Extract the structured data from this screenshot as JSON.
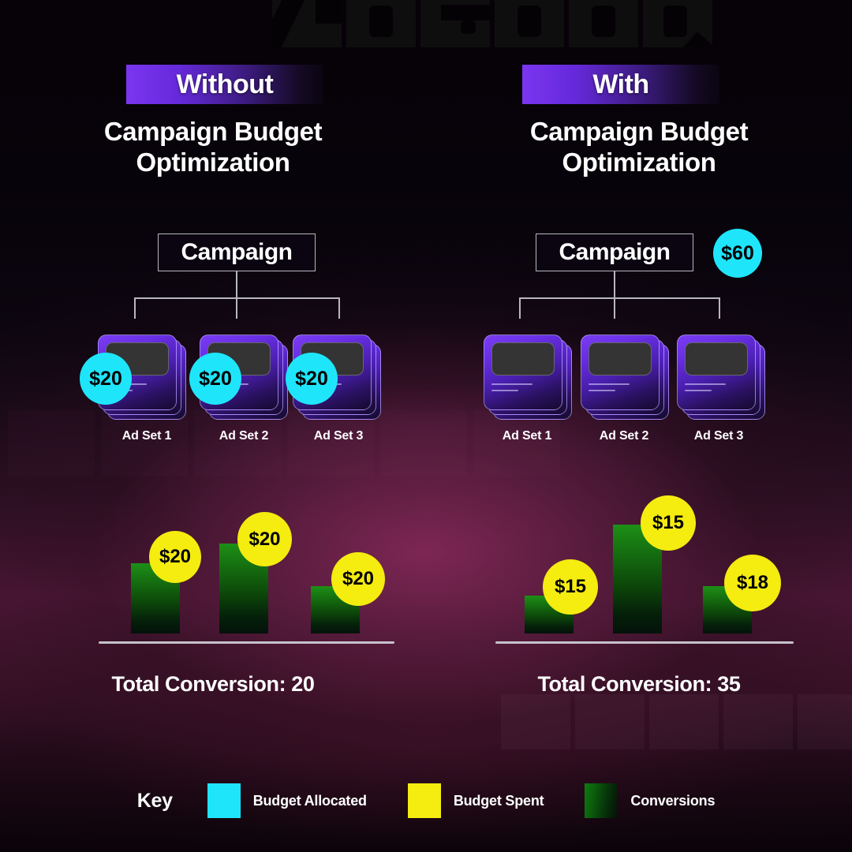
{
  "watermark": {
    "text": "NOGOOD"
  },
  "panels": [
    {
      "id": "without",
      "badge": "Without",
      "title_line1": "Campaign Budget",
      "title_line2": "Optimization",
      "campaign_label": "Campaign",
      "campaign_budget_bubble": "",
      "ad_sets": [
        {
          "label": "Ad Set 1",
          "allocated": "$20"
        },
        {
          "label": "Ad Set 2",
          "allocated": "$20"
        },
        {
          "label": "Ad Set 3",
          "allocated": "$20"
        }
      ],
      "spend_bubbles": [
        "$20",
        "$20",
        "$20"
      ],
      "total_conversion": "Total Conversion: 20"
    },
    {
      "id": "with",
      "badge": "With",
      "title_line1": "Campaign Budget",
      "title_line2": "Optimization",
      "campaign_label": "Campaign",
      "campaign_budget_bubble": "$60",
      "ad_sets": [
        {
          "label": "Ad Set 1",
          "allocated": ""
        },
        {
          "label": "Ad Set 2",
          "allocated": ""
        },
        {
          "label": "Ad Set 3",
          "allocated": ""
        }
      ],
      "spend_bubbles": [
        "$15",
        "$15",
        "$18"
      ],
      "total_conversion": "Total Conversion: 35"
    }
  ],
  "legend": {
    "key_label": "Key",
    "items": [
      {
        "swatch": "cyan",
        "color": "#1FE5FB",
        "label": "Budget Allocated"
      },
      {
        "swatch": "yellow",
        "color": "#F5EC10",
        "label": "Budget Spent"
      },
      {
        "swatch": "green",
        "color": "#0E7A10",
        "label": "Conversions"
      }
    ]
  },
  "chart_data": [
    {
      "type": "bar",
      "title": "Without Campaign Budget Optimization",
      "categories": [
        "Ad Set 1",
        "Ad Set 2",
        "Ad Set 3"
      ],
      "series": [
        {
          "name": "Conversions",
          "values": [
            7,
            9,
            4
          ]
        },
        {
          "name": "Budget Spent",
          "values": [
            20,
            20,
            20
          ]
        },
        {
          "name": "Budget Allocated",
          "values": [
            20,
            20,
            20
          ]
        }
      ],
      "data_labels": [
        "$20",
        "$20",
        "$20"
      ],
      "total_conversion": 20,
      "ylabel": "Conversions",
      "xlabel": "",
      "grid": false,
      "legend_position": "bottom"
    },
    {
      "type": "bar",
      "title": "With Campaign Budget Optimization",
      "categories": [
        "Ad Set 1",
        "Ad Set 2",
        "Ad Set 3"
      ],
      "series": [
        {
          "name": "Conversions",
          "values": [
            4,
            16,
            6
          ]
        },
        {
          "name": "Budget Spent",
          "values": [
            15,
            15,
            18
          ]
        },
        {
          "name": "Budget Allocated",
          "values": [
            60,
            60,
            60
          ]
        }
      ],
      "data_labels": [
        "$15",
        "$15",
        "$18"
      ],
      "total_conversion": 35,
      "ylabel": "Conversions",
      "xlabel": "",
      "grid": false,
      "legend_position": "bottom"
    }
  ]
}
